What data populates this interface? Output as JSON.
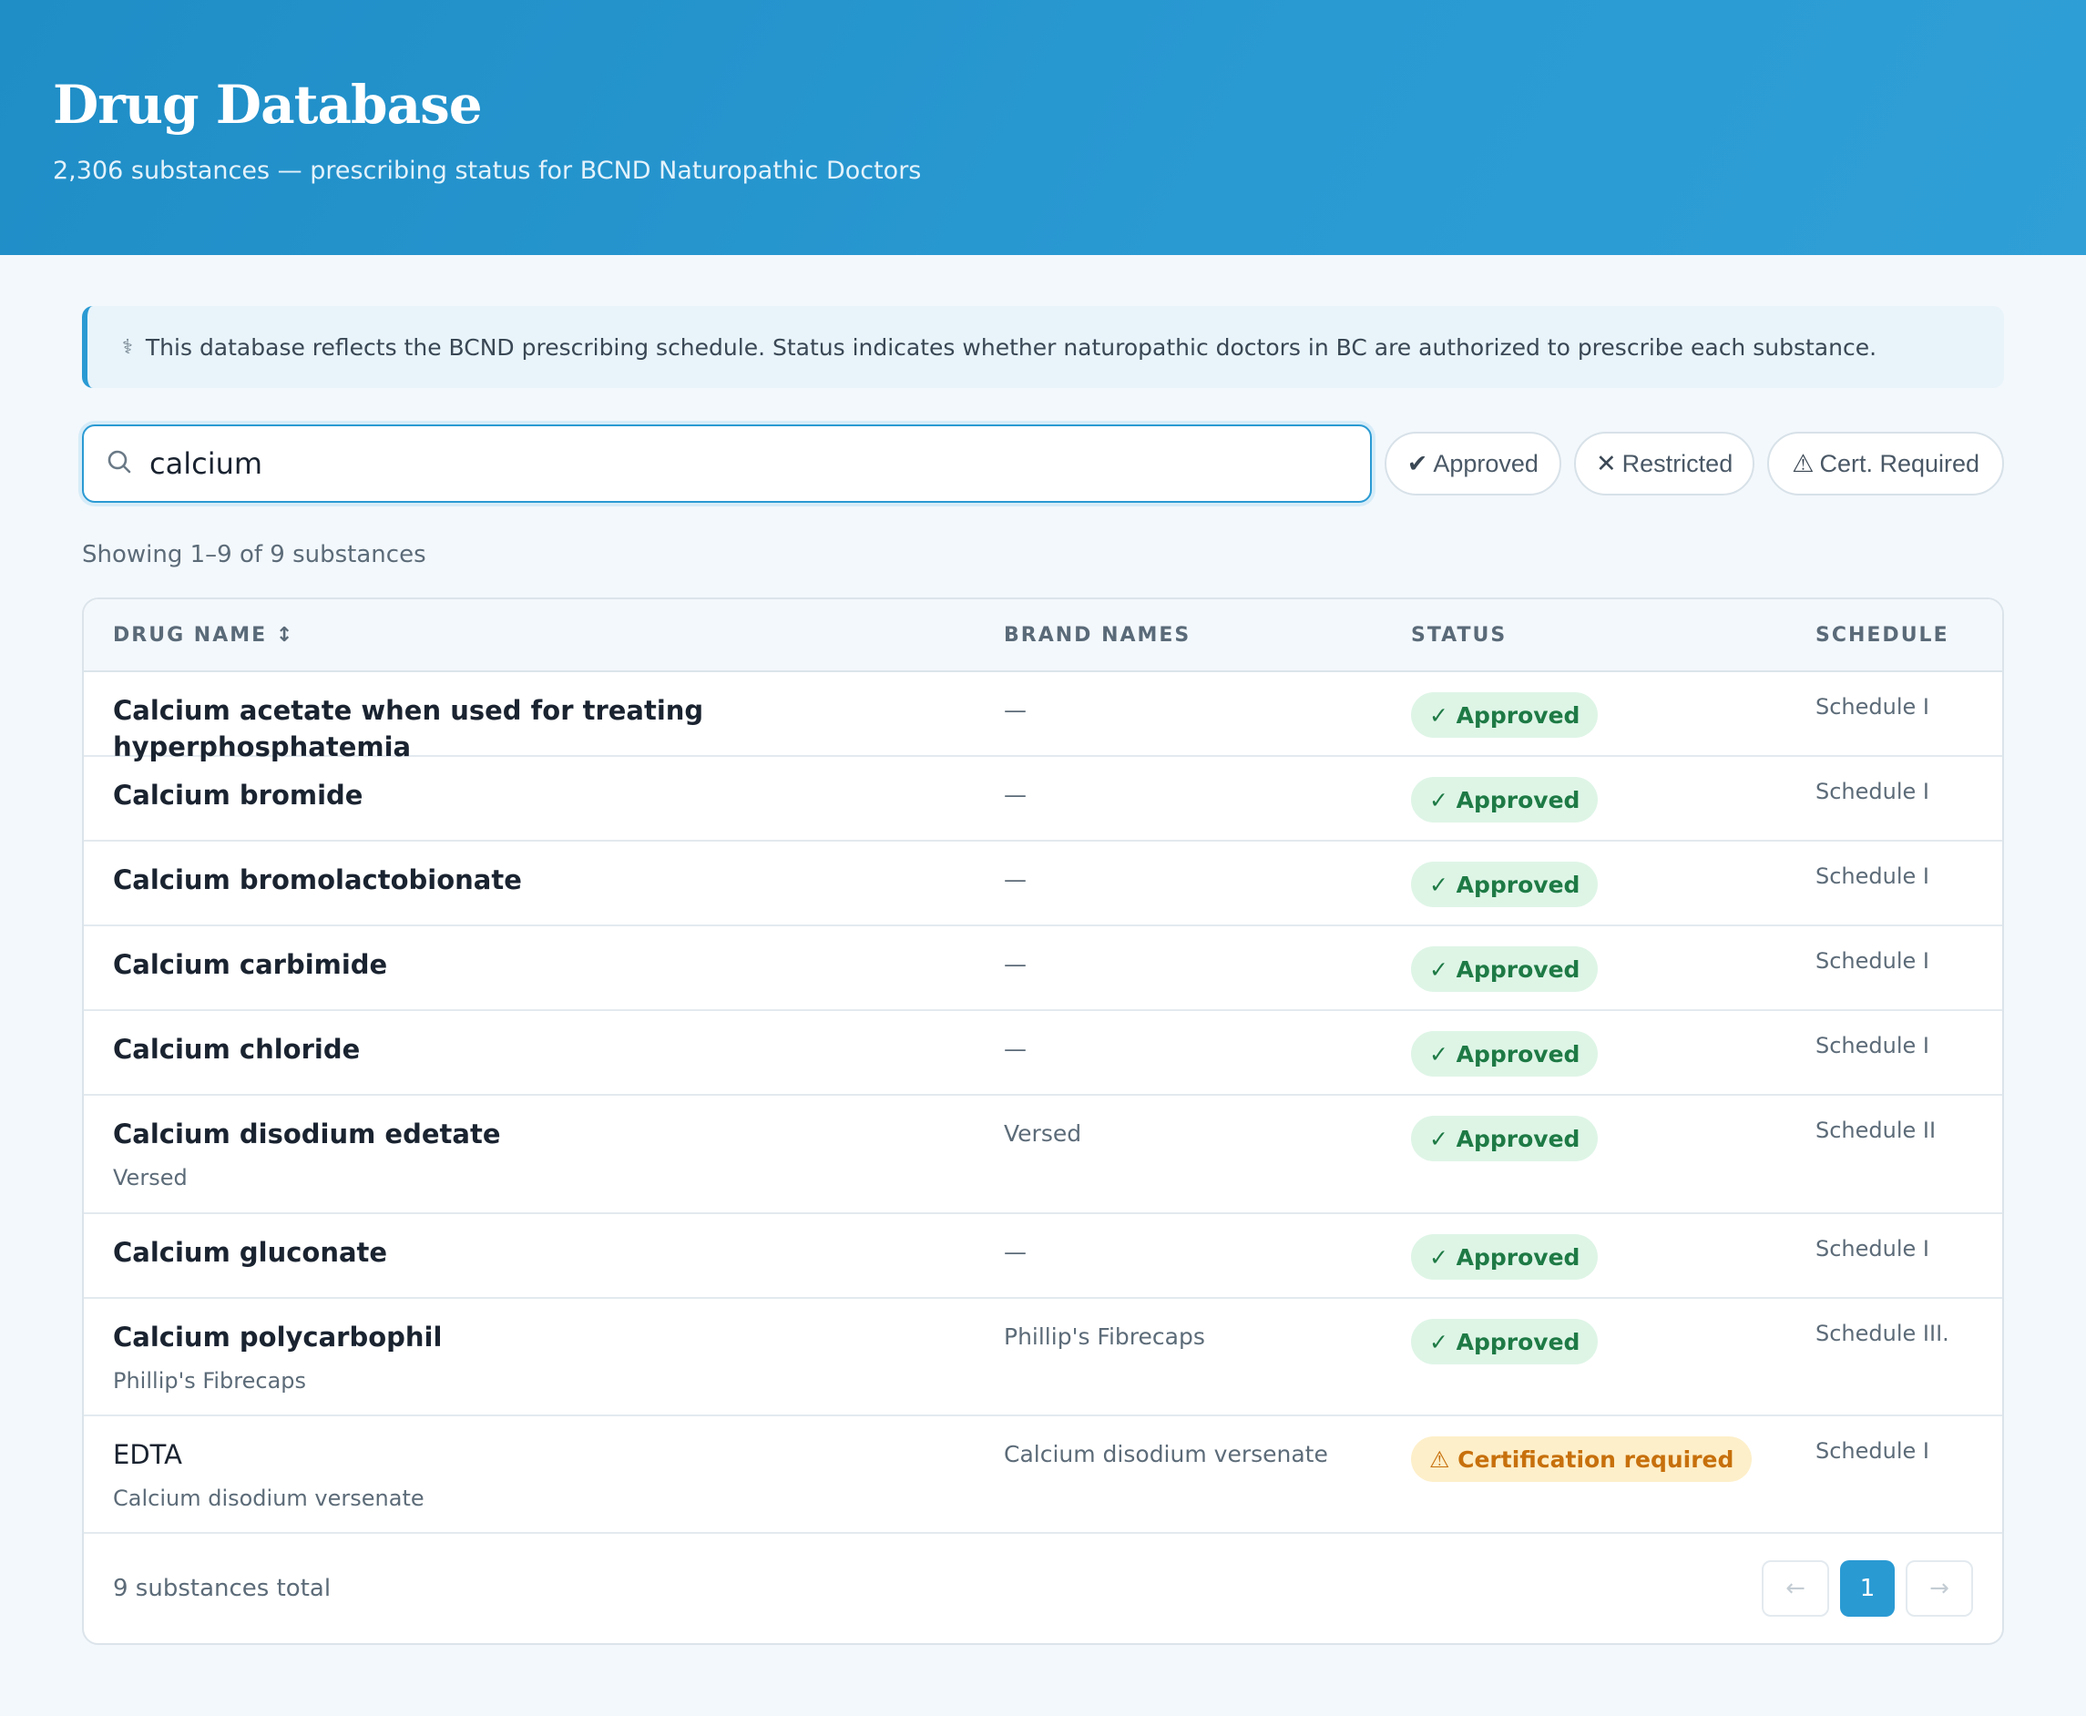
{
  "header": {
    "title": "Drug Database",
    "subtitle": "2,306 substances — prescribing status for BCND Naturopathic Doctors"
  },
  "notice": {
    "icon": "caduceus-icon",
    "text": "This database reflects the BCND prescribing schedule. Status indicates whether naturopathic doctors in BC are authorized to prescribe each substance."
  },
  "search": {
    "icon": "search-icon",
    "value": "calcium",
    "placeholder": ""
  },
  "filters": [
    {
      "icon": "check-icon",
      "glyph": "✔",
      "label": "Approved"
    },
    {
      "icon": "x-icon",
      "glyph": "✕",
      "label": "Restricted"
    },
    {
      "icon": "warning-icon",
      "glyph": "⚠",
      "label": "Cert. Required"
    }
  ],
  "results_count": "Showing 1–9 of 9 substances",
  "table": {
    "columns": {
      "drug_name": "DRUG NAME",
      "sort_icon": "↕",
      "brand_names": "BRAND NAMES",
      "status": "STATUS",
      "schedule": "SCHEDULE"
    },
    "rows": [
      {
        "name": "Calcium acetate when used for treating hyperphosphatemia",
        "sub": "",
        "brand": "—",
        "status": "✓ Approved",
        "status_type": "approved",
        "schedule": "Schedule I"
      },
      {
        "name": "Calcium bromide",
        "sub": "",
        "brand": "—",
        "status": "✓ Approved",
        "status_type": "approved",
        "schedule": "Schedule I"
      },
      {
        "name": "Calcium bromolactobionate",
        "sub": "",
        "brand": "—",
        "status": "✓ Approved",
        "status_type": "approved",
        "schedule": "Schedule I"
      },
      {
        "name": "Calcium carbimide",
        "sub": "",
        "brand": "—",
        "status": "✓ Approved",
        "status_type": "approved",
        "schedule": "Schedule I"
      },
      {
        "name": "Calcium chloride",
        "sub": "",
        "brand": "—",
        "status": "✓ Approved",
        "status_type": "approved",
        "schedule": "Schedule I"
      },
      {
        "name": "Calcium disodium edetate",
        "sub": "Versed",
        "brand": "Versed",
        "status": "✓ Approved",
        "status_type": "approved",
        "schedule": "Schedule II"
      },
      {
        "name": "Calcium gluconate",
        "sub": "",
        "brand": "—",
        "status": "✓ Approved",
        "status_type": "approved",
        "schedule": "Schedule I"
      },
      {
        "name": "Calcium polycarbophil",
        "sub": "Phillip's Fibrecaps",
        "brand": "Phillip's Fibrecaps",
        "status": "✓ Approved",
        "status_type": "approved",
        "schedule": "Schedule III."
      },
      {
        "name": "EDTA",
        "sub": "Calcium disodium versenate",
        "brand": "Calcium disodium versenate",
        "status": "⚠ Certification required",
        "status_type": "cert",
        "schedule": "Schedule I"
      }
    ]
  },
  "footer": {
    "total": "9 substances total",
    "prev": "←",
    "current_page": "1",
    "next": "→"
  },
  "colors": {
    "accent": "#2a9ad3",
    "approved_bg": "#def5e6",
    "approved_text": "#1e7a45",
    "cert_bg": "#fdefc9",
    "cert_text": "#c7700c"
  }
}
